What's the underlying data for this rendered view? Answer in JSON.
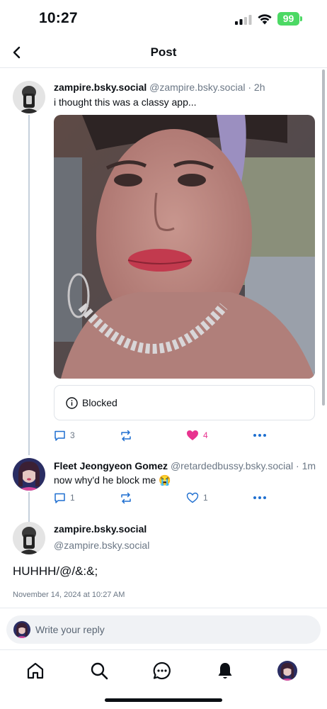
{
  "status_bar": {
    "time": "10:27",
    "battery": "99"
  },
  "header": {
    "title": "Post"
  },
  "posts": [
    {
      "author": "zampire.bsky.social",
      "handle": "@zampire.bsky.social",
      "time": "· 2h",
      "text": "i thought this was a classy app...",
      "blocked_label": "Blocked",
      "replies": "3",
      "likes": "4"
    },
    {
      "author": "Fleet Jeongyeon Gomez",
      "handle": "@retardedbussy.bsky.social",
      "time": "· 1m",
      "text": "now why'd he block me 😭",
      "replies": "1",
      "likes": "1"
    }
  ],
  "focused_post": {
    "author": "zampire.bsky.social",
    "handle": "@zampire.bsky.social",
    "text": "HUHHH/@/&:&;",
    "timestamp": "November 14, 2024 at 10:27 AM"
  },
  "reply": {
    "placeholder": "Write your reply"
  },
  "nav": {
    "items": [
      "home-icon",
      "search-icon",
      "chat-icon",
      "notifications-icon",
      "profile-avatar"
    ]
  },
  "colors": {
    "like_active": "#e8338f",
    "muted_text": "#6b7785",
    "action_icon": "#1f6fd0",
    "battery": "#4cd964"
  }
}
